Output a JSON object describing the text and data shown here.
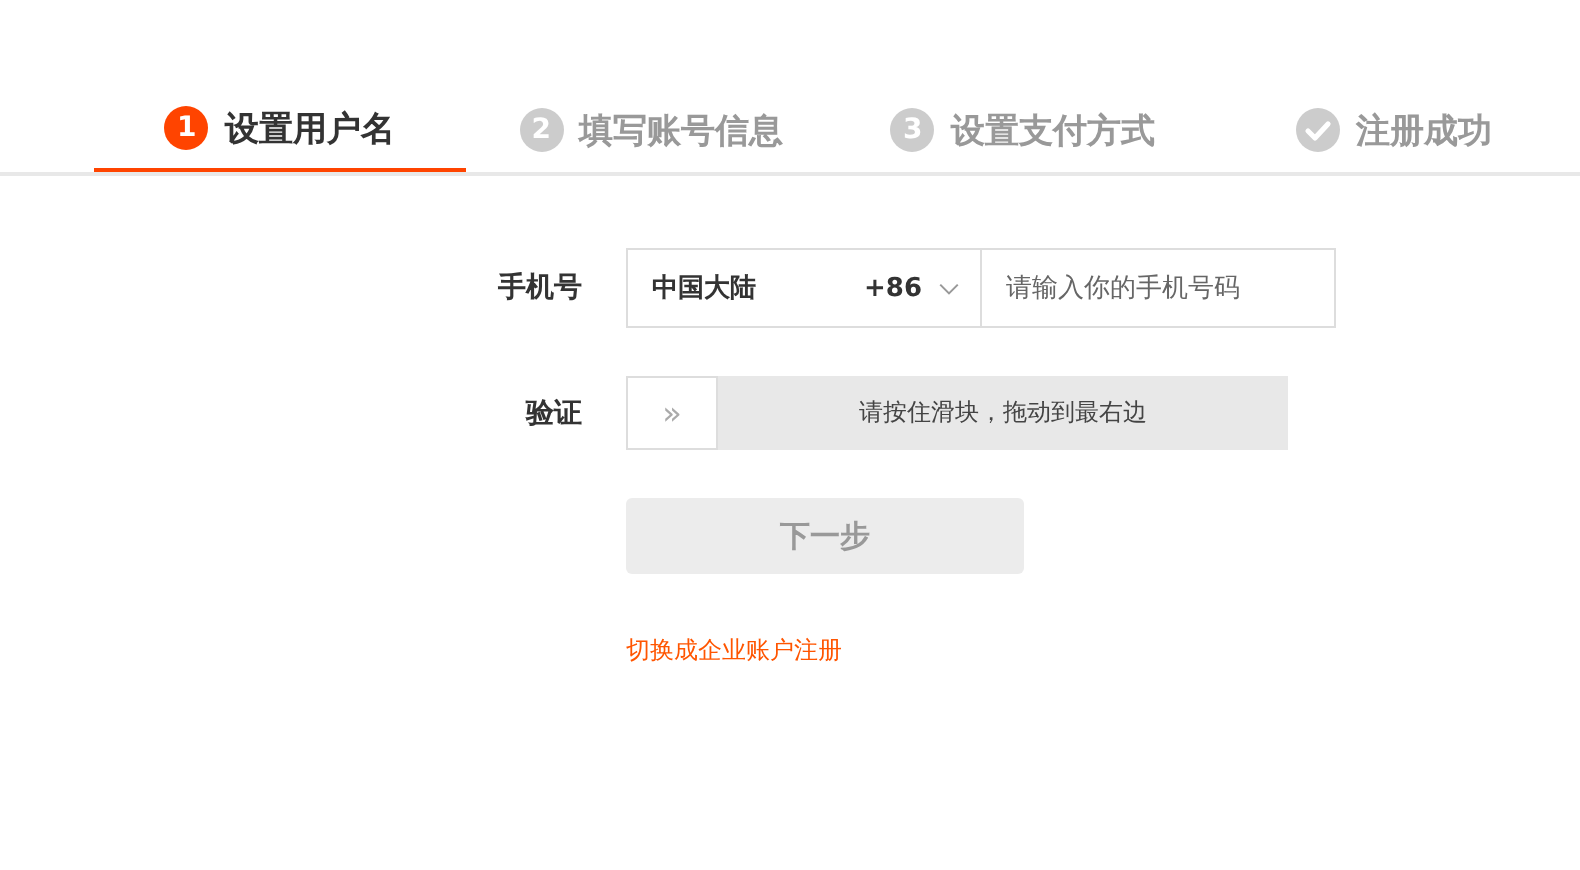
{
  "steps": [
    {
      "kind": "number",
      "number": "1",
      "label": "设置用户名",
      "selected": true
    },
    {
      "kind": "number",
      "number": "2",
      "label": "填写账号信息",
      "selected": false
    },
    {
      "kind": "number",
      "number": "3",
      "label": "设置支付方式",
      "selected": false
    },
    {
      "kind": "check",
      "label": "注册成功",
      "selected": false
    }
  ],
  "phone": {
    "label": "手机号",
    "country": "中国大陆",
    "code": "+86",
    "placeholder": "请输入你的手机号码"
  },
  "verify": {
    "label": "验证",
    "handle": "»",
    "hint": "请按住滑块，拖动到最右边"
  },
  "next_button": {
    "label": "下一步",
    "disabled": true
  },
  "switch_link": "切换成企业账户注册"
}
